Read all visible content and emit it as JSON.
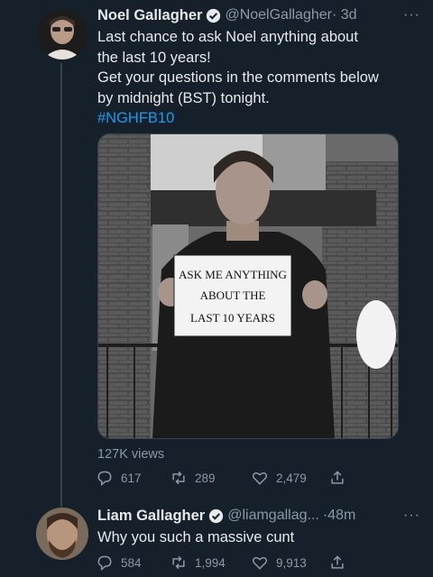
{
  "tweet1": {
    "name": "Noel Gallagher",
    "handle": "@NoelGallagher",
    "time": "· 3d",
    "more": "···",
    "text_lines": [
      "Last chance to ask Noel anything about",
      "the last 10 years!",
      "Get your questions in the comments below",
      "by midnight (BST) tonight."
    ],
    "hashtag": "#NGHFB10",
    "sign_lines": [
      "ASK ME ANYTHING",
      "ABOUT THE",
      "LAST 10 YEARS"
    ],
    "views": "127K views",
    "replies": "617",
    "retweets": "289",
    "likes": "2,479"
  },
  "tweet2": {
    "name": "Liam Gallagher",
    "handle": "@liamgallag...",
    "time": "·48m",
    "more": "···",
    "text": "Why you such a massive cunt",
    "replies": "584",
    "retweets": "1,994",
    "likes": "9,913"
  },
  "icons": {
    "verified": "verified-badge-icon",
    "reply": "reply-icon",
    "retweet": "retweet-icon",
    "like": "heart-icon",
    "share": "share-icon"
  },
  "colors": {
    "background": "#15202b",
    "accent": "#1d9bf0",
    "muted": "#8b98a5"
  }
}
